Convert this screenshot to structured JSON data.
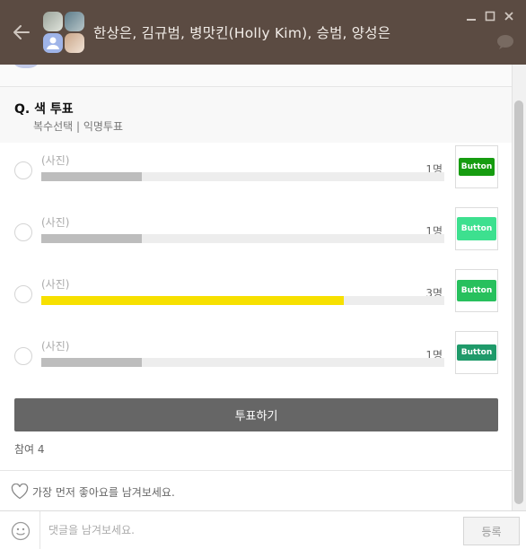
{
  "titlebar": {
    "title": "한상은, 김규범, 병맛킨(Holly Kim), 승범, 양성은",
    "bg_color": "#5b4b42"
  },
  "poll": {
    "question": "Q. 색 투표",
    "meta": "복수선택 | 익명투표",
    "options": [
      {
        "label": "(사진)",
        "count": "1명",
        "fraction": 0.25,
        "bar_color": "#bdbdbd",
        "thumb_text": "Button",
        "thumb_color": "#169c10"
      },
      {
        "label": "(사진)",
        "count": "1명",
        "fraction": 0.25,
        "bar_color": "#bdbdbd",
        "thumb_text": "Button",
        "thumb_color": "#3de08f"
      },
      {
        "label": "(사진)",
        "count": "3명",
        "fraction": 0.75,
        "bar_color": "#f7e000",
        "thumb_text": "Button",
        "thumb_color": "#27c05d"
      },
      {
        "label": "(사진)",
        "count": "1명",
        "fraction": 0.25,
        "bar_color": "#bdbdbd",
        "thumb_text": "Button",
        "thumb_color": "#1f9a6a"
      }
    ],
    "vote_button": "투표하기",
    "participants": "참여 4"
  },
  "like_prompt": "가장 먼저 좋아요를 남겨보세요.",
  "comment": {
    "placeholder": "댓글을 남겨보세요.",
    "value": "",
    "submit": "등록"
  }
}
